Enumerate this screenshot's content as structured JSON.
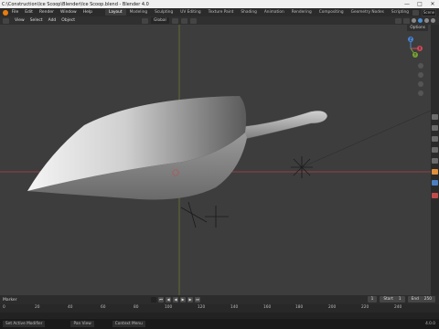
{
  "window": {
    "title": "C:\\Construction\\Ice Scoop\\Blender\\Ice Scoop.blend - Blender 4.0",
    "buttons": [
      "—",
      "□",
      "✕"
    ]
  },
  "menubar": {
    "items": [
      "File",
      "Edit",
      "Render",
      "Window",
      "Help"
    ],
    "workspaces": [
      "Layout",
      "Modeling",
      "Sculpting",
      "UV Editing",
      "Texture Paint",
      "Shading",
      "Animation",
      "Rendering",
      "Compositing",
      "Geometry Nodes",
      "Scripting"
    ],
    "active_workspace": "Layout",
    "scene_label": "Scene"
  },
  "viewport_header": {
    "mode": "Object Mode",
    "menus": [
      "View",
      "Select",
      "Add",
      "Object"
    ],
    "transform": "Global",
    "options_label": "Options"
  },
  "viewport": {
    "background_color": "#3d3d3d",
    "x_axis_color": "#b0404a",
    "y_axis_color": "#8a9a2a",
    "gizmo": {
      "x": "X",
      "y": "Y",
      "z": "Z"
    }
  },
  "timeline": {
    "label": "Marker",
    "current_frame": "1",
    "start_label": "Start",
    "start_value": "1",
    "end_label": "End",
    "end_value": "250",
    "ticks": [
      "0",
      "20",
      "40",
      "60",
      "80",
      "100",
      "120",
      "140",
      "160",
      "180",
      "200",
      "220",
      "240"
    ]
  },
  "statusbar": {
    "items": [
      "Set Active Modifier",
      "Pan View",
      "Context Menu"
    ],
    "version": "4.0.0"
  }
}
